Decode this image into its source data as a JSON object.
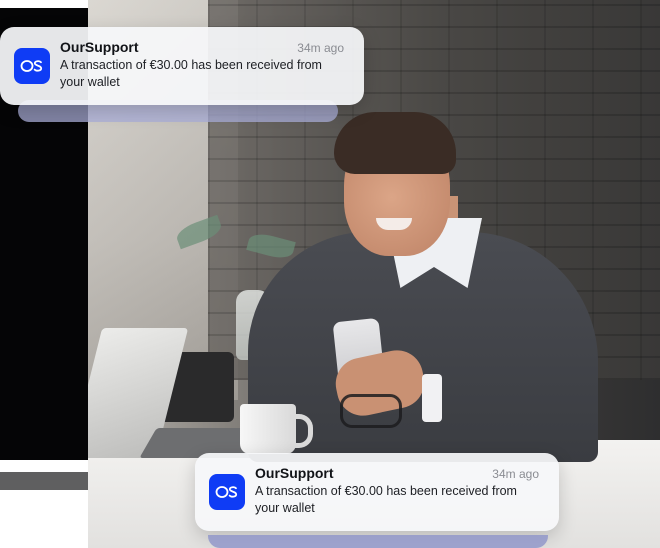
{
  "notifications": [
    {
      "app_name": "OurSupport",
      "time": "34m ago",
      "message": "A transaction of €30.00 has been received from your wallet",
      "icon": "oursupport-app-icon"
    },
    {
      "app_name": "OurSupport",
      "time": "34m ago",
      "message": "A transaction of €30.00 has been received from your wallet",
      "icon": "oursupport-app-icon"
    }
  ],
  "colors": {
    "brand": "#0f3cf5",
    "card_background": "#f6f7fa",
    "stack_accent": "#a9aed8"
  }
}
